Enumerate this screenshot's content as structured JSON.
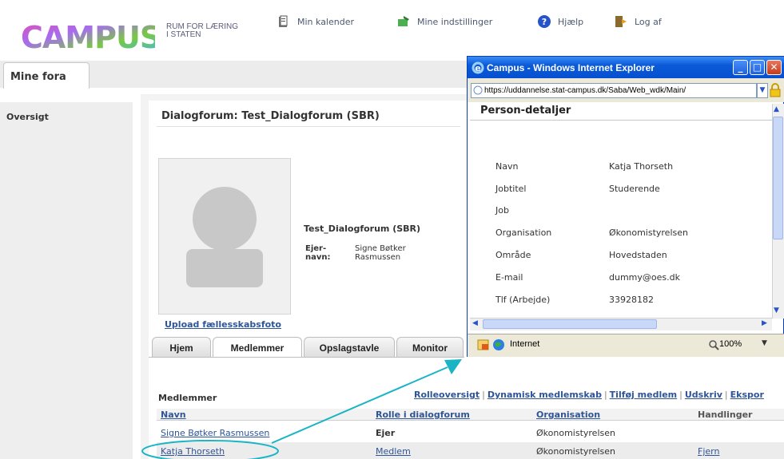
{
  "brand": {
    "logo_text": "CAMPUS",
    "tagline_line1": "RUM FOR LÆRING",
    "tagline_line2": "I STATEN"
  },
  "topnav": [
    {
      "label": "Min kalender",
      "icon": "calendar-icon"
    },
    {
      "label": "Mine indstillinger",
      "icon": "settings-icon"
    },
    {
      "label": "Hjælp",
      "icon": "help-icon"
    },
    {
      "label": "Log af",
      "icon": "logout-icon"
    }
  ],
  "main_tab": "Mine fora",
  "sidebar": {
    "items": [
      {
        "label": "Oversigt"
      }
    ]
  },
  "forum": {
    "title": "Dialogforum: Test_Dialogforum (SBR)",
    "name": "Test_Dialogforum (SBR)",
    "owner_label_line1": "Ejer-",
    "owner_label_line2": "navn:",
    "owner_value_line1": "Signe Bøtker",
    "owner_value_line2": "Rasmussen",
    "upload_link": "Upload fællesskabsfoto"
  },
  "subtabs": [
    {
      "label": "Hjem",
      "active": false
    },
    {
      "label": "Medlemmer",
      "active": true
    },
    {
      "label": "Opslagstavle",
      "active": false
    },
    {
      "label": "Monitor",
      "active": false
    }
  ],
  "members": {
    "heading": "Medlemmer",
    "actions": [
      "Rolleoversigt",
      "Dynamisk medlemskab",
      "Tilføj medlem",
      "Udskriv",
      "Ekspor"
    ],
    "columns": [
      "Navn",
      "Rolle i dialogforum",
      "Organisation",
      "Handlinger"
    ],
    "rows": [
      {
        "name": "Signe Bøtker Rasmussen",
        "role": "Ejer",
        "org": "Økonomistyrelsen",
        "action": ""
      },
      {
        "name": "Katja Thorseth",
        "role": "Medlem",
        "org": "Økonomistyrelsen",
        "action": "Fjern"
      }
    ]
  },
  "popup": {
    "title": "Campus - Windows Internet Explorer",
    "address": "https://uddannelse.stat-campus.dk/Saba/Web_wdk/Main/",
    "heading": "Person-detaljer",
    "fields": [
      {
        "label": "Navn",
        "value": "Katja Thorseth"
      },
      {
        "label": "Jobtitel",
        "value": "Studerende"
      },
      {
        "label": "Job",
        "value": ""
      },
      {
        "label": "Organisation",
        "value": "Økonomistyrelsen"
      },
      {
        "label": "Område",
        "value": "Hovedstaden"
      },
      {
        "label": "E-mail",
        "value": "dummy@oes.dk"
      },
      {
        "label": "Tlf (Arbejde)",
        "value": "33928182"
      }
    ],
    "status_zone": "Internet",
    "zoom": "100%"
  },
  "colors": {
    "link": "#2f5597",
    "annotation": "#19b5c4",
    "titlebar": "#0a5ad8"
  }
}
